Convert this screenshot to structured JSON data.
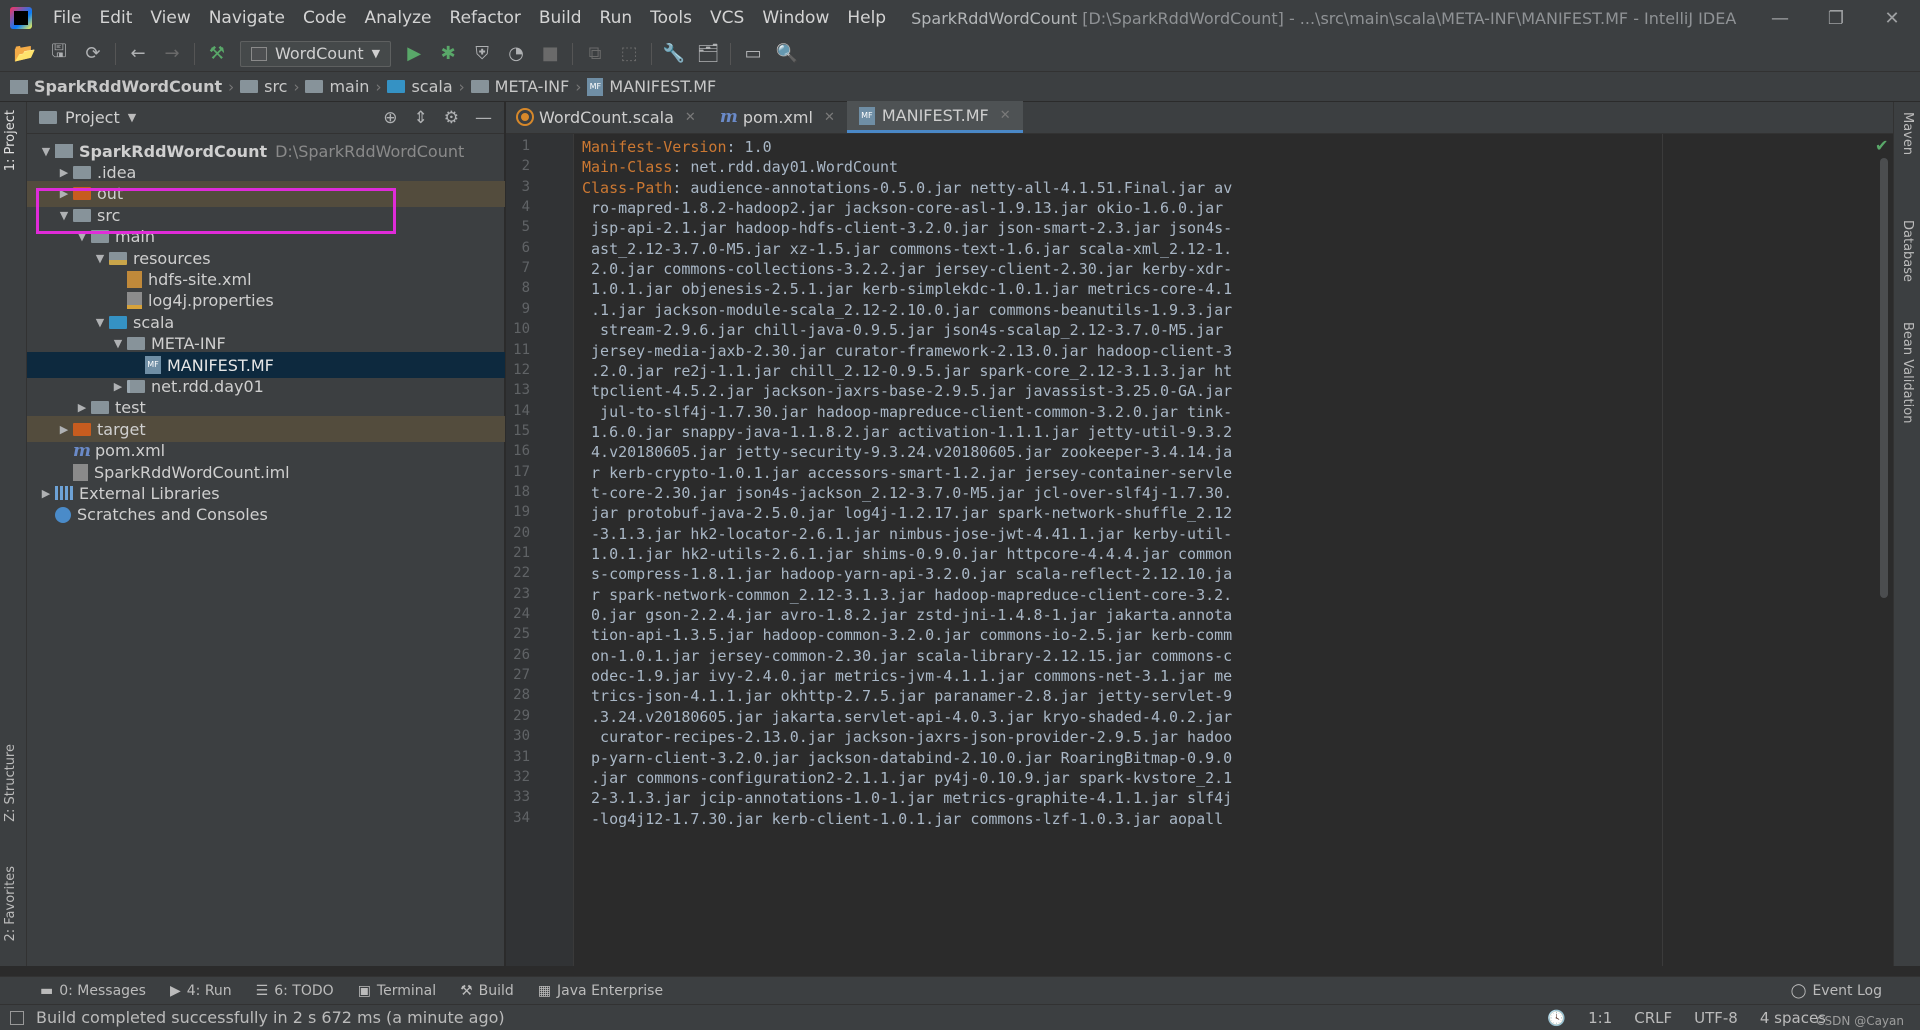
{
  "menu": [
    "File",
    "Edit",
    "View",
    "Navigate",
    "Code",
    "Analyze",
    "Refactor",
    "Build",
    "Run",
    "Tools",
    "VCS",
    "Window",
    "Help"
  ],
  "window_title": {
    "project": "SparkRddWordCount",
    "rest": "[D:\\SparkRddWordCount] - ...\\src\\main\\scala\\META-INF\\MANIFEST.MF - IntelliJ IDEA"
  },
  "toolbar": {
    "run_config": "WordCount"
  },
  "breadcrumb": [
    "SparkRddWordCount",
    "src",
    "main",
    "scala",
    "META-INF",
    "MANIFEST.MF"
  ],
  "project_panel": {
    "title": "Project",
    "tree": [
      {
        "label": "SparkRddWordCount",
        "path": "D:\\SparkRddWordCount",
        "icon": "project-folder-icon",
        "level": 0,
        "arrow": "down"
      },
      {
        "label": ".idea",
        "icon": "folder-icon",
        "level": 1,
        "arrow": "right"
      },
      {
        "label": "out",
        "icon": "excluded-folder-icon",
        "level": 1,
        "arrow": "right"
      },
      {
        "label": "src",
        "icon": "folder-icon",
        "level": 1,
        "arrow": "down"
      },
      {
        "label": "main",
        "icon": "folder-icon",
        "level": 2,
        "arrow": "down"
      },
      {
        "label": "resources",
        "icon": "resources-folder-icon",
        "level": 3,
        "arrow": "down"
      },
      {
        "label": "hdfs-site.xml",
        "icon": "xml-file-icon",
        "level": 4,
        "arrow": ""
      },
      {
        "label": "log4j.properties",
        "icon": "properties-file-icon",
        "level": 4,
        "arrow": ""
      },
      {
        "label": "scala",
        "icon": "source-folder-icon",
        "level": 3,
        "arrow": "down"
      },
      {
        "label": "META-INF",
        "icon": "folder-icon",
        "level": 4,
        "arrow": "down"
      },
      {
        "label": "MANIFEST.MF",
        "icon": "manifest-file-icon",
        "level": 5,
        "arrow": ""
      },
      {
        "label": "net.rdd.day01",
        "icon": "package-icon",
        "level": 4,
        "arrow": "right"
      },
      {
        "label": "test",
        "icon": "folder-icon",
        "level": 2,
        "arrow": "right"
      },
      {
        "label": "target",
        "icon": "excluded-folder-icon",
        "level": 1,
        "arrow": "right"
      },
      {
        "label": "pom.xml",
        "icon": "maven-icon",
        "level": 1,
        "arrow": ""
      },
      {
        "label": "SparkRddWordCount.iml",
        "icon": "iml-file-icon",
        "level": 1,
        "arrow": ""
      },
      {
        "label": "External Libraries",
        "icon": "libraries-icon",
        "level": 0,
        "arrow": "right"
      },
      {
        "label": "Scratches and Consoles",
        "icon": "scratches-icon",
        "level": 0,
        "arrow": ""
      }
    ]
  },
  "editor_tabs": [
    {
      "label": "WordCount.scala",
      "icon": "scala-file-icon",
      "active": false
    },
    {
      "label": "pom.xml",
      "icon": "maven-icon",
      "active": false
    },
    {
      "label": "MANIFEST.MF",
      "icon": "manifest-file-icon",
      "active": true
    }
  ],
  "editor_lines": [
    {
      "key": "Manifest-Version",
      "value": ": 1.0"
    },
    {
      "key": "Main-Class",
      "value": ": net.rdd.day01.WordCount"
    },
    {
      "key": "Class-Path",
      "value": ": audience-annotations-0.5.0.jar netty-all-4.1.51.Final.jar av"
    },
    {
      "key": "",
      "value": " ro-mapred-1.8.2-hadoop2.jar jackson-core-asl-1.9.13.jar okio-1.6.0.jar"
    },
    {
      "key": "",
      "value": " jsp-api-2.1.jar hadoop-hdfs-client-3.2.0.jar json-smart-2.3.jar json4s-"
    },
    {
      "key": "",
      "value": " ast_2.12-3.7.0-M5.jar xz-1.5.jar commons-text-1.6.jar scala-xml_2.12-1."
    },
    {
      "key": "",
      "value": " 2.0.jar commons-collections-3.2.2.jar jersey-client-2.30.jar kerby-xdr-"
    },
    {
      "key": "",
      "value": " 1.0.1.jar objenesis-2.5.1.jar kerb-simplekdc-1.0.1.jar metrics-core-4.1"
    },
    {
      "key": "",
      "value": " .1.jar jackson-module-scala_2.12-2.10.0.jar commons-beanutils-1.9.3.jar"
    },
    {
      "key": "",
      "value": "  stream-2.9.6.jar chill-java-0.9.5.jar json4s-scalap_2.12-3.7.0-M5.jar"
    },
    {
      "key": "",
      "value": " jersey-media-jaxb-2.30.jar curator-framework-2.13.0.jar hadoop-client-3"
    },
    {
      "key": "",
      "value": " .2.0.jar re2j-1.1.jar chill_2.12-0.9.5.jar spark-core_2.12-3.1.3.jar ht"
    },
    {
      "key": "",
      "value": " tpclient-4.5.2.jar jackson-jaxrs-base-2.9.5.jar javassist-3.25.0-GA.jar"
    },
    {
      "key": "",
      "value": "  jul-to-slf4j-1.7.30.jar hadoop-mapreduce-client-common-3.2.0.jar tink-"
    },
    {
      "key": "",
      "value": " 1.6.0.jar snappy-java-1.1.8.2.jar activation-1.1.1.jar jetty-util-9.3.2"
    },
    {
      "key": "",
      "value": " 4.v20180605.jar jetty-security-9.3.24.v20180605.jar zookeeper-3.4.14.ja"
    },
    {
      "key": "",
      "value": " r kerb-crypto-1.0.1.jar accessors-smart-1.2.jar jersey-container-servle"
    },
    {
      "key": "",
      "value": " t-core-2.30.jar json4s-jackson_2.12-3.7.0-M5.jar jcl-over-slf4j-1.7.30."
    },
    {
      "key": "",
      "value": " jar protobuf-java-2.5.0.jar log4j-1.2.17.jar spark-network-shuffle_2.12"
    },
    {
      "key": "",
      "value": " -3.1.3.jar hk2-locator-2.6.1.jar nimbus-jose-jwt-4.41.1.jar kerby-util-"
    },
    {
      "key": "",
      "value": " 1.0.1.jar hk2-utils-2.6.1.jar shims-0.9.0.jar httpcore-4.4.4.jar common"
    },
    {
      "key": "",
      "value": " s-compress-1.8.1.jar hadoop-yarn-api-3.2.0.jar scala-reflect-2.12.10.ja"
    },
    {
      "key": "",
      "value": " r spark-network-common_2.12-3.1.3.jar hadoop-mapreduce-client-core-3.2."
    },
    {
      "key": "",
      "value": " 0.jar gson-2.2.4.jar avro-1.8.2.jar zstd-jni-1.4.8-1.jar jakarta.annota"
    },
    {
      "key": "",
      "value": " tion-api-1.3.5.jar hadoop-common-3.2.0.jar commons-io-2.5.jar kerb-comm"
    },
    {
      "key": "",
      "value": " on-1.0.1.jar jersey-common-2.30.jar scala-library-2.12.15.jar commons-c"
    },
    {
      "key": "",
      "value": " odec-1.9.jar ivy-2.4.0.jar metrics-jvm-4.1.1.jar commons-net-3.1.jar me"
    },
    {
      "key": "",
      "value": " trics-json-4.1.1.jar okhttp-2.7.5.jar paranamer-2.8.jar jetty-servlet-9"
    },
    {
      "key": "",
      "value": " .3.24.v20180605.jar jakarta.servlet-api-4.0.3.jar kryo-shaded-4.0.2.jar"
    },
    {
      "key": "",
      "value": "  curator-recipes-2.13.0.jar jackson-jaxrs-json-provider-2.9.5.jar hadoo"
    },
    {
      "key": "",
      "value": " p-yarn-client-3.2.0.jar jackson-databind-2.10.0.jar RoaringBitmap-0.9.0"
    },
    {
      "key": "",
      "value": " .jar commons-configuration2-2.1.1.jar py4j-0.10.9.jar spark-kvstore_2.1"
    },
    {
      "key": "",
      "value": " 2-3.1.3.jar jcip-annotations-1.0-1.jar metrics-graphite-4.1.1.jar slf4j"
    },
    {
      "key": "",
      "value": " -log4j12-1.7.30.jar kerb-client-1.0.1.jar commons-lzf-1.0.3.jar aopall"
    }
  ],
  "left_stripe": {
    "project": "1: Project",
    "structure": "Z: Structure",
    "favorites": "2: Favorites"
  },
  "right_stripe": {
    "maven": "Maven",
    "database": "Database",
    "bean_validation": "Bean Validation"
  },
  "tool_windows": [
    {
      "label": "0: Messages",
      "icon": "messages-icon"
    },
    {
      "label": "4: Run",
      "icon": "run-icon"
    },
    {
      "label": "6: TODO",
      "icon": "todo-icon"
    },
    {
      "label": "Terminal",
      "icon": "terminal-icon"
    },
    {
      "label": "Build",
      "icon": "build-icon"
    },
    {
      "label": "Java Enterprise",
      "icon": "java-enterprise-icon"
    }
  ],
  "event_log": "Event Log",
  "status": {
    "message": "Build completed successfully in 2 s 672 ms (a minute ago)",
    "position": "1:1",
    "line_sep": "CRLF",
    "encoding": "UTF-8",
    "indent": "4 spaces",
    "watermark": "CSDN @Cayan"
  },
  "colors": {
    "highlight_box": "#e02bd9",
    "keyword": "#cc7832",
    "selection": "#0d293e",
    "excluded": "#534c3d"
  }
}
